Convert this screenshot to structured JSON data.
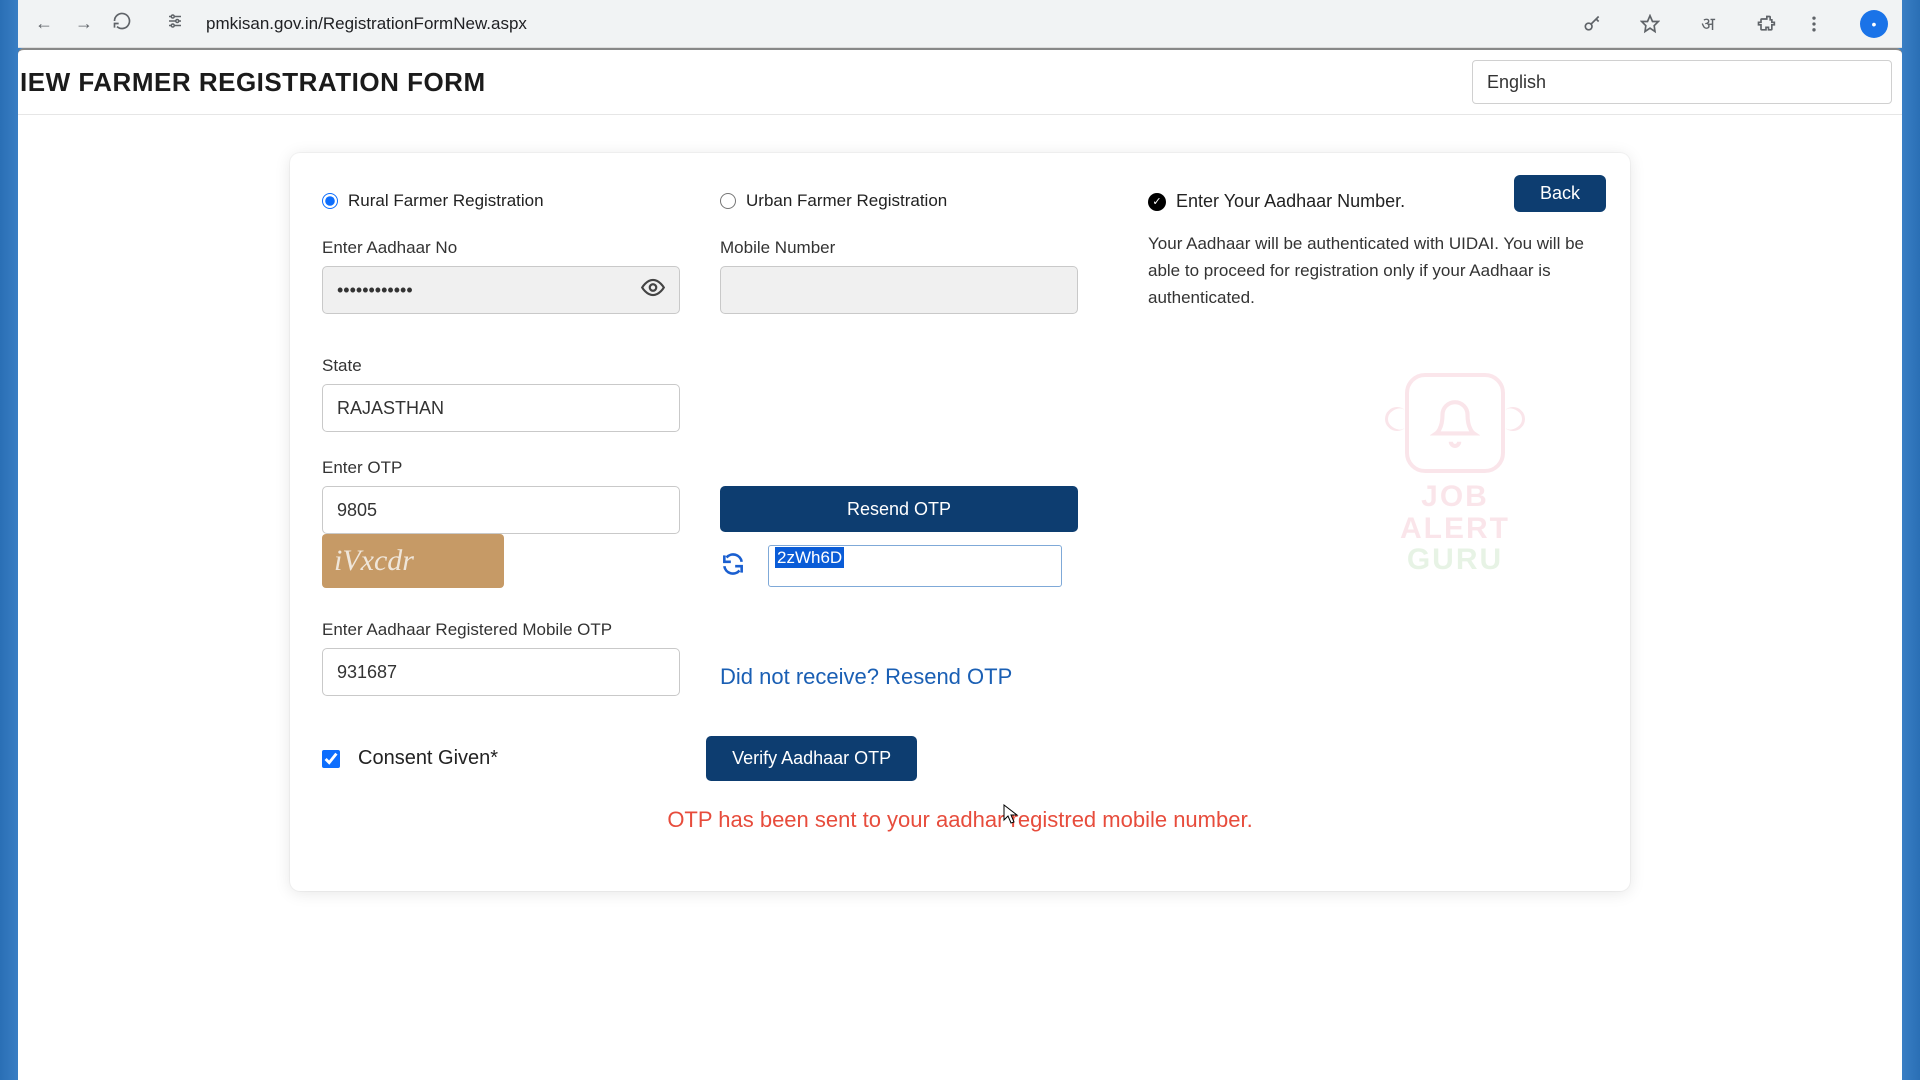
{
  "browser": {
    "url": "pmkisan.gov.in/RegistrationFormNew.aspx",
    "translate_glyph": "अ"
  },
  "header": {
    "top_strip": "",
    "title": "IEW FARMER REGISTRATION FORM",
    "language_selected": "English"
  },
  "buttons": {
    "back": "Back",
    "resend_otp": "Resend OTP",
    "verify": "Verify Aadhaar OTP"
  },
  "radios": {
    "rural": "Rural Farmer Registration",
    "urban": "Urban Farmer Registration"
  },
  "labels": {
    "aadhaar": "Enter Aadhaar No",
    "mobile": "Mobile Number",
    "state": "State",
    "enter_otp": "Enter OTP",
    "aadhaar_mobile_otp": "Enter Aadhaar Registered Mobile OTP",
    "aad_heading": "Enter Your Aadhaar Number.",
    "aad_desc": "Your Aadhaar will be authenticated with UIDAI. You will be able to proceed for registration only if your Aadhaar is authenticated.",
    "consent": "Consent Given*",
    "resend_link": "Did not receive? Resend OTP"
  },
  "values": {
    "aadhaar_masked": "••••••••••••",
    "mobile": "",
    "state": "RAJASTHAN",
    "otp": "9805",
    "captcha_shown": "iVxcdr",
    "captcha_entered": "2zWh6D",
    "aadhaar_mobile_otp": "931687",
    "consent_checked": true
  },
  "status": {
    "message": "OTP has been sent to your aadhar registred mobile number."
  },
  "watermark": {
    "line1": "JOB",
    "line2": "ALERT",
    "line3": "GURU"
  }
}
